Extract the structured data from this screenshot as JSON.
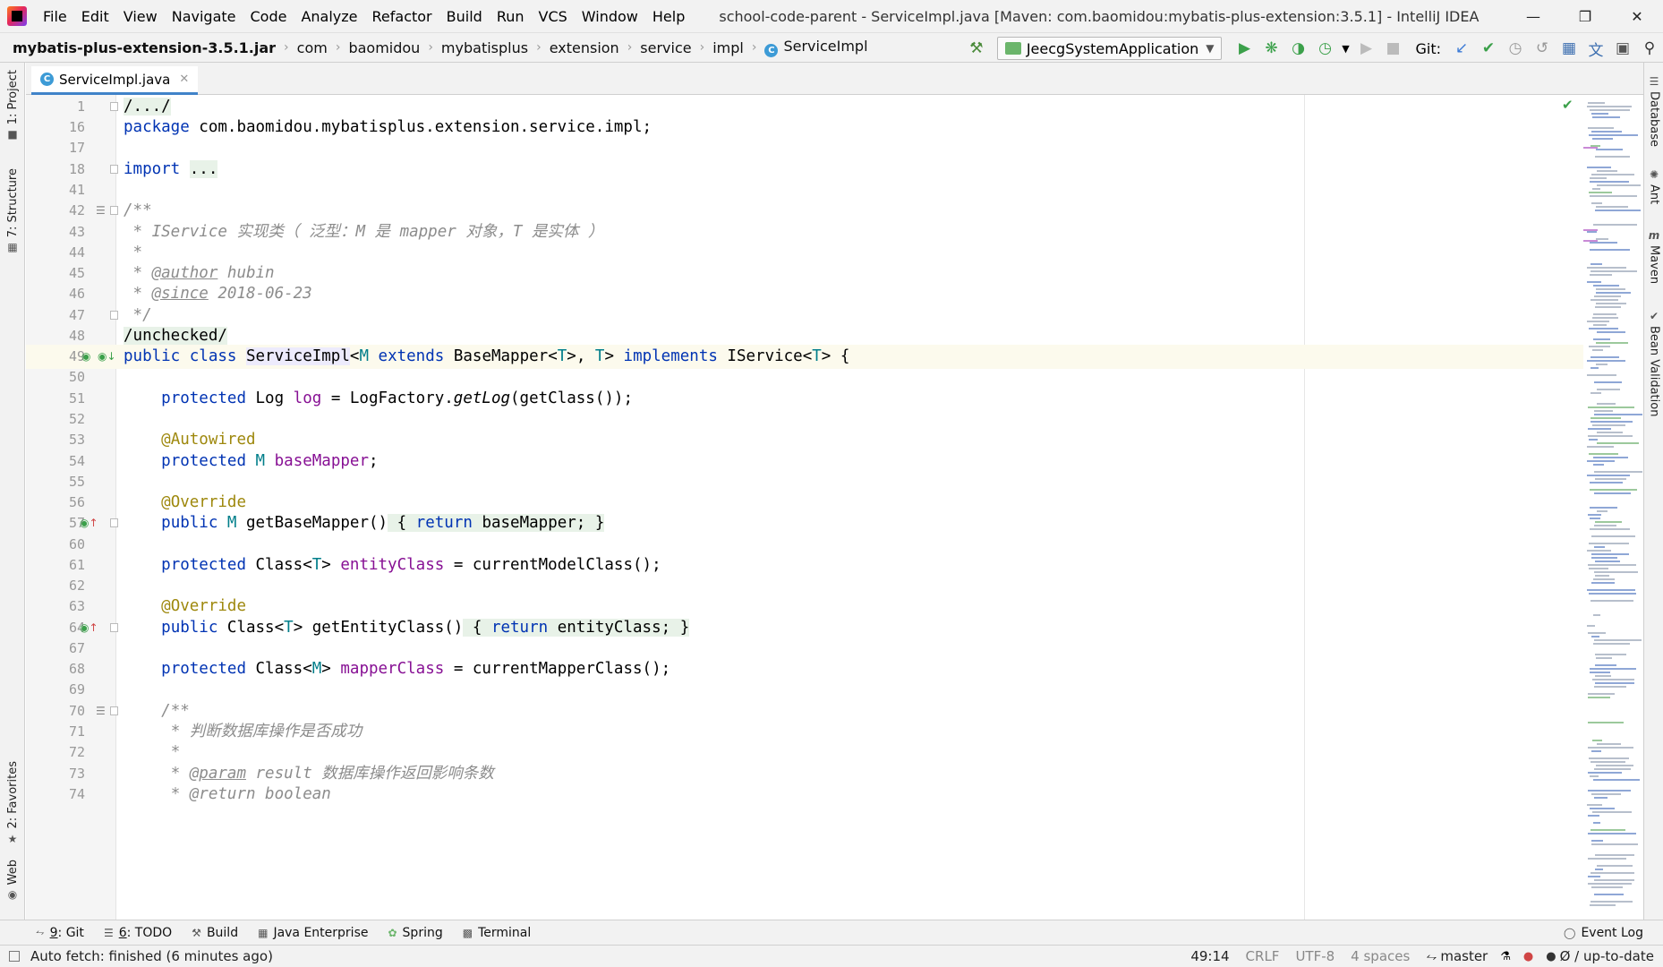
{
  "menu": {
    "items": [
      "File",
      "Edit",
      "View",
      "Navigate",
      "Code",
      "Analyze",
      "Refactor",
      "Build",
      "Run",
      "VCS",
      "Window",
      "Help"
    ]
  },
  "window": {
    "title": "school-code-parent - ServiceImpl.java [Maven: com.baomidou:mybatis-plus-extension:3.5.1] - IntelliJ IDEA"
  },
  "breadcrumb": [
    "mybatis-plus-extension-3.5.1.jar",
    "com",
    "baomidou",
    "mybatisplus",
    "extension",
    "service",
    "impl",
    "ServiceImpl"
  ],
  "run_config": {
    "label": "JeecgSystemApplication"
  },
  "git": {
    "label": "Git:"
  },
  "left_tabs": [
    "1: Project",
    "7: Structure",
    "2: Favorites",
    "Web"
  ],
  "right_tabs": [
    "Database",
    "Ant",
    "Maven",
    "Bean Validation"
  ],
  "editor": {
    "tab_label": "ServiceImpl.java",
    "class_badge": "C",
    "lines": [
      "1",
      "16",
      "17",
      "18",
      "41",
      "42",
      "43",
      "44",
      "45",
      "46",
      "47",
      "48",
      "49",
      "50",
      "51",
      "52",
      "53",
      "54",
      "55",
      "56",
      "57",
      "60",
      "61",
      "62",
      "63",
      "64",
      "67",
      "68",
      "69",
      "70",
      "71",
      "72",
      "73",
      "74"
    ],
    "code": {
      "l1": "/.../",
      "l16_kw": "package",
      "l16_rest": " com.baomidou.mybatisplus.extension.service.impl;",
      "l18_kw": "import",
      "l18_rest": "...",
      "l42": "/**",
      "l43": " * IService 实现类（ 泛型：M 是 mapper 对象，T 是实体 ）",
      "l44": " *",
      "l45_pre": " * ",
      "l45_tag": "@author",
      "l45_rest": " hubin",
      "l46_pre": " * ",
      "l46_tag": "@since",
      "l46_rest": " 2018-06-23",
      "l47": " */",
      "l48": "/unchecked/",
      "l49_a": "public class",
      "l49_name": "ServiceImpl",
      "l49_b": "<",
      "l49_M": "M",
      "l49_ext": "extends",
      "l49_bm": "BaseMapper<",
      "l49_T1": "T",
      "l49_c": ">, ",
      "l49_T2": "T",
      "l49_c2": "> ",
      "l49_impl": "implements",
      "l49_is": " IService<",
      "l49_T3": "T",
      "l49_end": "> {",
      "l51_kw": "protected",
      "l51_a": " Log ",
      "l51_fld": "log",
      "l51_b": " = LogFactory.",
      "l51_it": "getLog",
      "l51_c": "(getClass());",
      "l53": "@Autowired",
      "l54_kw": "protected",
      "l54_tp": "M",
      "l54_fld": "baseMapper",
      "l54_end": ";",
      "l56": "@Override",
      "l57_kw": "public",
      "l57_tp": "M",
      "l57_a": "getBaseMapper()",
      "l57_b1": " { ",
      "l57_ret": "return",
      "l57_fld": "baseMapper",
      "l57_b2": "; }",
      "l61_kw": "protected",
      "l61_a": " Class<",
      "l61_tp": "T",
      "l61_b": "> ",
      "l61_fld": "entityClass",
      "l61_c": " = currentModelClass();",
      "l63": "@Override",
      "l64_kw": "public",
      "l64_a": " Class<",
      "l64_tp": "T",
      "l64_b": "> getEntityClass()",
      "l64_b1": " { ",
      "l64_ret": "return",
      "l64_fld": "entityClass",
      "l64_b2": "; }",
      "l68_kw": "protected",
      "l68_a": " Class<",
      "l68_tp": "M",
      "l68_b": "> ",
      "l68_fld": "mapperClass",
      "l68_c": " = currentMapperClass();",
      "l70": "/**",
      "l71": " * 判断数据库操作是否成功",
      "l72": " *",
      "l73_pre": " * ",
      "l73_tag": "@param",
      "l73_rest": " result ",
      "l73_cmt": "数据库操作返回影响条数",
      "l74": " * @return boolean"
    }
  },
  "bottom_tabs": [
    {
      "num": "9",
      "label": ": Git",
      "icon": "git-icon"
    },
    {
      "num": "6",
      "label": ": TODO",
      "icon": "todo-icon"
    },
    {
      "num": "",
      "label": "Build",
      "icon": "build-icon"
    },
    {
      "num": "",
      "label": "Java Enterprise",
      "icon": "java-enterprise-icon"
    },
    {
      "num": "",
      "label": "Spring",
      "icon": "spring-icon"
    },
    {
      "num": "",
      "label": "Terminal",
      "icon": "terminal-icon"
    }
  ],
  "event_log": "Event Log",
  "status": {
    "message": "Auto fetch: finished (6 minutes ago)",
    "position": "49:14",
    "line_sep": "CRLF",
    "encoding": "UTF-8",
    "indent": "4 spaces",
    "branch": "master",
    "vcs_status": "Ø / up-to-date"
  }
}
